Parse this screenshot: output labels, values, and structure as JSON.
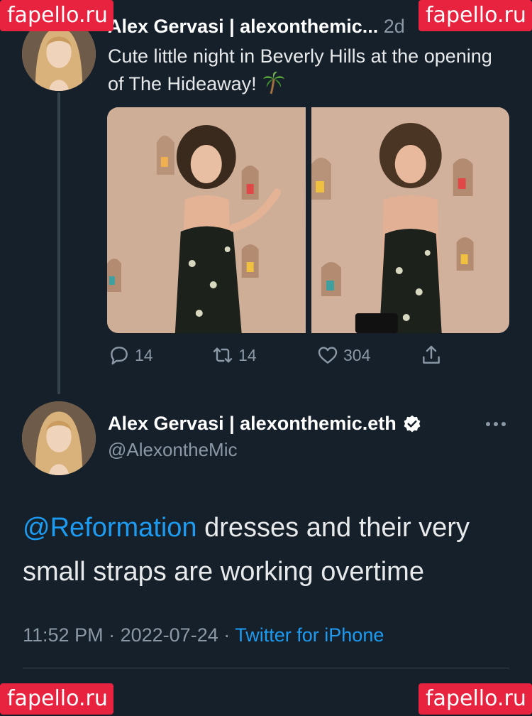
{
  "watermark": "fapello.ru",
  "tweet1": {
    "author": "Alex Gervasi | alexonthemic...",
    "time": "2d",
    "text": "Cute little night in Beverly Hills at the opening of The Hideaway!",
    "emoji": "palm-tree",
    "media_count": 2,
    "actions": {
      "replies": "14",
      "retweets": "14",
      "likes": "304"
    }
  },
  "tweet2": {
    "display_name": "Alex Gervasi | alexonthemic.eth",
    "handle": "@AlexontheMic",
    "mention": "@Reformation",
    "text": " dresses and their very small straps are working overtime",
    "time": "11:52 PM",
    "date": "2022-07-24",
    "source": "Twitter for iPhone",
    "separator": "·"
  },
  "colors": {
    "background": "#15202b",
    "accent": "#1d9bf0",
    "muted": "#8b98a5",
    "watermark": "#e8233f"
  },
  "icons": [
    "reply-icon",
    "retweet-icon",
    "like-icon",
    "share-icon",
    "verified-badge-icon",
    "more-icon",
    "palm-tree-icon"
  ]
}
